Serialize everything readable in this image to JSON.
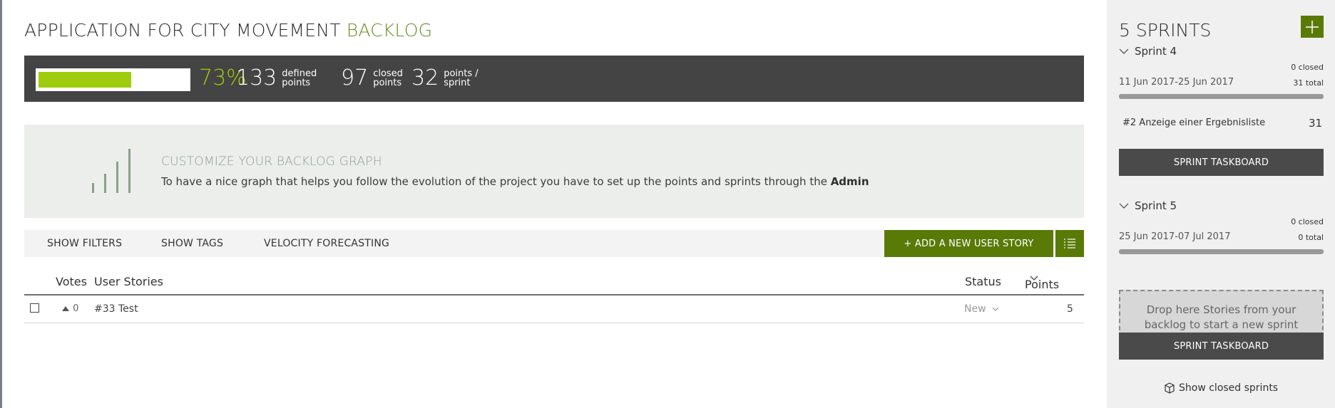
{
  "project": {
    "title": "APPLICATION FOR CITY MOVEMENT",
    "section": "BACKLOG"
  },
  "summary": {
    "progress_percent": 73,
    "percent_label": "73%",
    "defined_points": "133",
    "defined_label": "defined\npoints",
    "closed_points": "97",
    "closed_label": "closed\npoints",
    "points_per_sprint": "32",
    "points_per_sprint_label": "points /\nsprint"
  },
  "graph": {
    "heading": "CUSTOMIZE YOUR BACKLOG GRAPH",
    "text": "To have a nice graph that helps you follow the evolution of the project you have to set up the points and sprints through the ",
    "link": "Admin"
  },
  "toolbar": {
    "show_filters": "SHOW FILTERS",
    "show_tags": "SHOW TAGS",
    "velocity": "VELOCITY FORECASTING",
    "add_story": "+ ADD A NEW USER STORY"
  },
  "table": {
    "columns": {
      "votes": "Votes",
      "stories": "User Stories",
      "status": "Status",
      "points": "Points"
    },
    "rows": [
      {
        "votes": "0",
        "story": "#33 Test",
        "status": "New",
        "points": "5"
      }
    ]
  },
  "sidebar": {
    "title": "5 SPRINTS",
    "sprints": [
      {
        "name": "Sprint 4",
        "closed": "0 closed",
        "total": "31 total",
        "dates": "11 Jun 2017-25 Jun 2017",
        "story": "#2 Anzeige einer Ergebnisliste",
        "story_points": "31",
        "taskboard": "SPRINT TASKBOARD"
      },
      {
        "name": "Sprint 5",
        "closed": "0 closed",
        "total": "0 total",
        "dates": "25 Jun 2017-07 Jul 2017",
        "drop_text": "Drop here Stories from your backlog to start a new sprint",
        "taskboard": "SPRINT TASKBOARD"
      }
    ],
    "show_closed": "Show closed sprints"
  },
  "colors": {
    "accent_green": "#5a7a08",
    "progress_green": "#9dcd0d",
    "summary_bg": "#444444"
  }
}
